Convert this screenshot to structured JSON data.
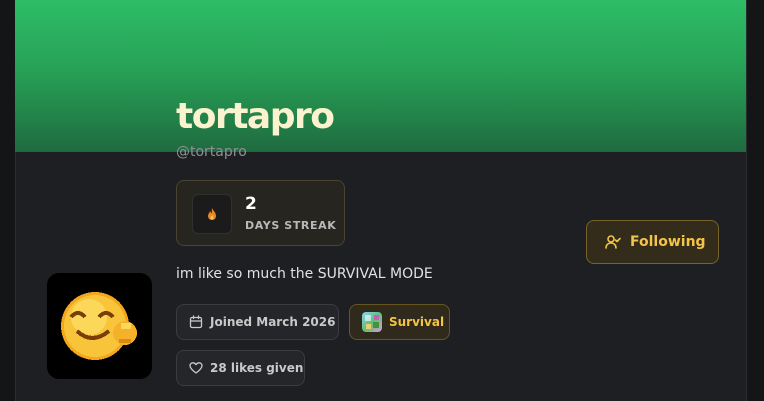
{
  "profile": {
    "display_name": "tortapro",
    "handle": "@tortapro",
    "bio": "im like so much the SURVIVAL MODE"
  },
  "streak": {
    "count": "2",
    "label": "DAYS STREAK",
    "icon": "flame-icon"
  },
  "actions": {
    "follow_label": "Following"
  },
  "meta": {
    "joined": "Joined March 2026",
    "game": "Survival",
    "likes": "28 likes given"
  },
  "colors": {
    "banner_top": "#2ebd66",
    "banner_bottom": "#1f6b3f",
    "accent": "#f4c444",
    "name": "#fbf3cf",
    "card_bg": "#1e1f22"
  }
}
